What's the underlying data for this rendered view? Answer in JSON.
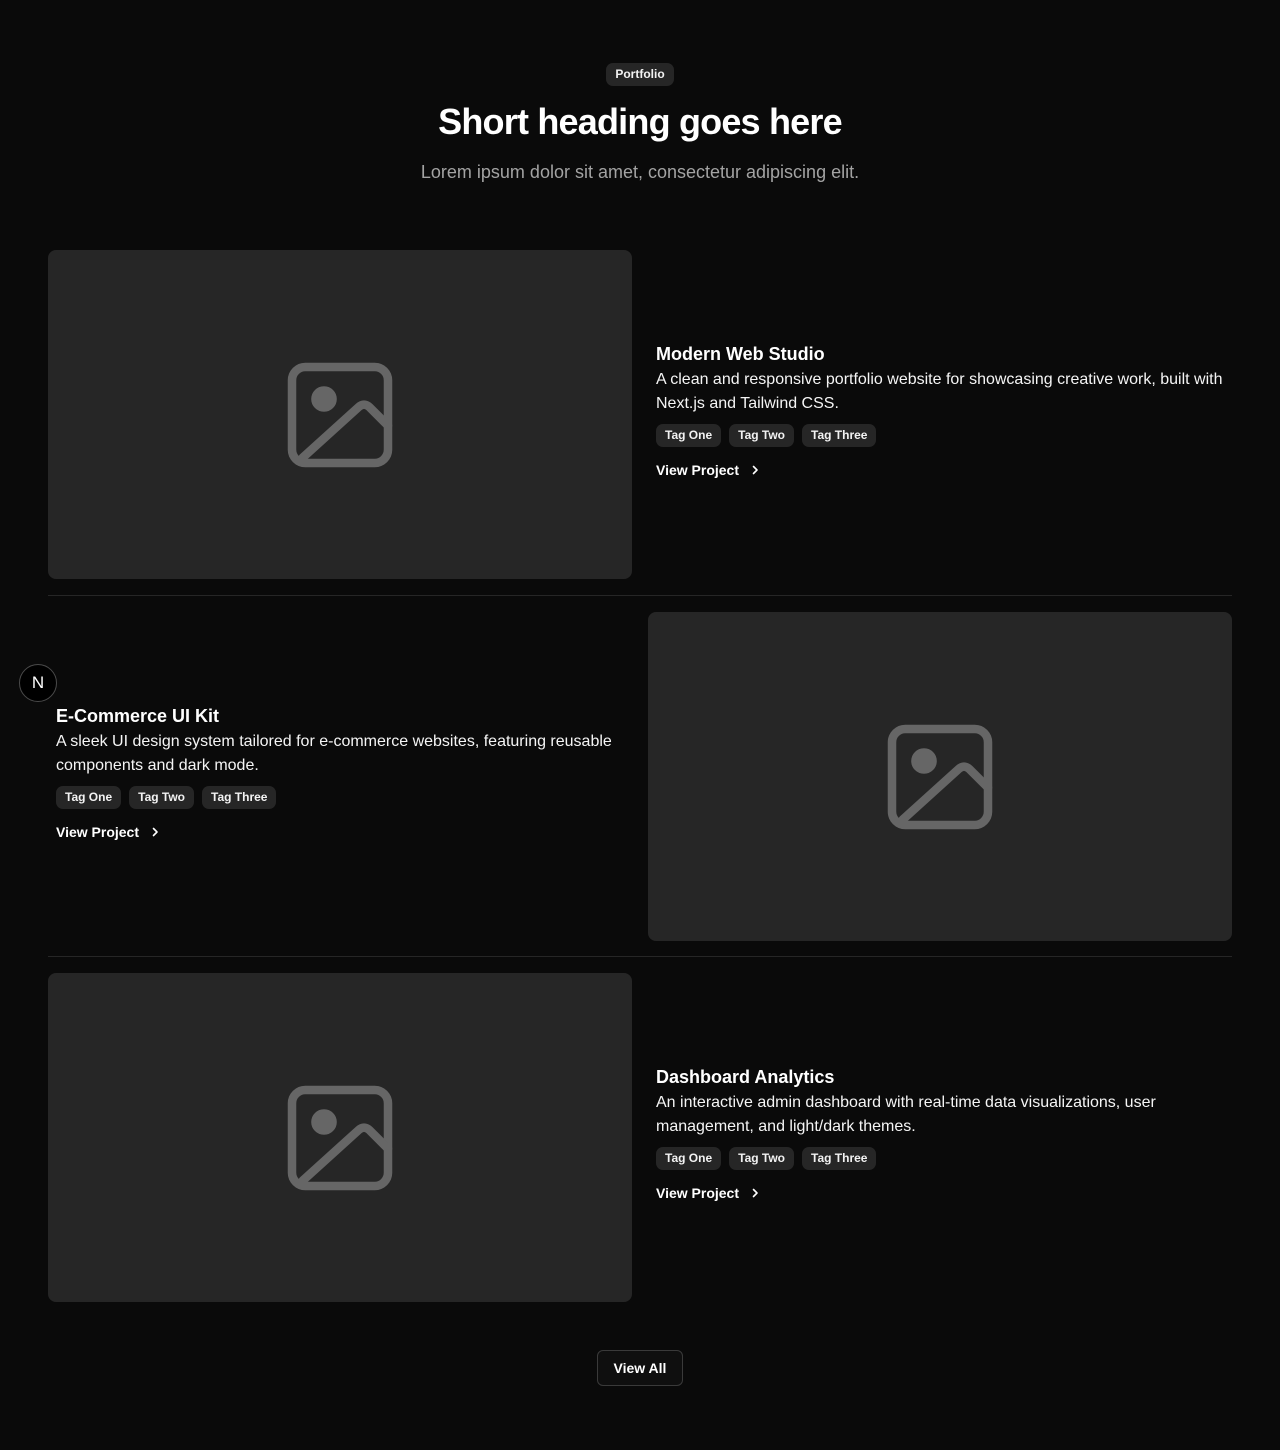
{
  "header": {
    "badge": "Portfolio",
    "heading": "Short heading goes here",
    "subheading": "Lorem ipsum dolor sit amet, consectetur adipiscing elit."
  },
  "projects": [
    {
      "title": "Modern Web Studio",
      "description": "A clean and responsive portfolio website for showcasing creative work, built with Next.js and Tailwind CSS.",
      "tags": [
        "Tag One",
        "Tag Two",
        "Tag Three"
      ],
      "link_label": "View Project"
    },
    {
      "title": "E-Commerce UI Kit",
      "description": "A sleek UI design system tailored for e-commerce websites, featuring reusable components and dark mode.",
      "tags": [
        "Tag One",
        "Tag Two",
        "Tag Three"
      ],
      "link_label": "View Project"
    },
    {
      "title": "Dashboard Analytics",
      "description": "An interactive admin dashboard with real-time data visualizations, user management, and light/dark themes.",
      "tags": [
        "Tag One",
        "Tag Two",
        "Tag Three"
      ],
      "link_label": "View Project"
    }
  ],
  "footer": {
    "view_all_label": "View All"
  },
  "dev_badge": {
    "letter": "N"
  },
  "icons": {
    "image_placeholder": "image-placeholder-icon",
    "link_chevron": "chevron-right-icon"
  },
  "colors": {
    "background": "#0a0a0a",
    "surface": "#262626",
    "placeholder_icon": "#666666",
    "text": "#ffffff",
    "muted_text": "#a3a3a3"
  }
}
